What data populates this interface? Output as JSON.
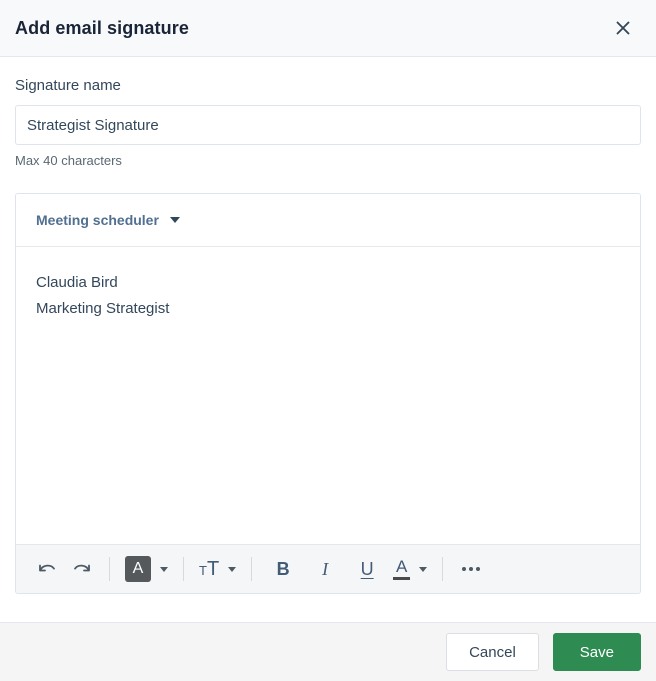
{
  "header": {
    "title": "Add email signature",
    "close_icon": "close-icon"
  },
  "form": {
    "name_label": "Signature name",
    "name_value": "Strategist Signature",
    "name_placeholder": "Signature name",
    "helper_text": "Max 40 characters"
  },
  "editor": {
    "dropdown_label": "Meeting scheduler",
    "dropdown_caret_icon": "chevron-down-icon",
    "signature_lines": [
      "Claudia Bird",
      "Marketing Strategist"
    ],
    "toolbar": {
      "undo_icon": "undo-icon",
      "redo_icon": "redo-icon",
      "font_family_label": "A",
      "font_family_caret_icon": "chevron-down-icon",
      "font_size_small_label": "T",
      "font_size_large_label": "T",
      "font_size_caret_icon": "chevron-down-icon",
      "bold_label": "B",
      "italic_label": "I",
      "underline_label": "U",
      "text_color_label": "A",
      "text_color_caret_icon": "chevron-down-icon",
      "more_icon": "ellipsis-icon"
    }
  },
  "footer": {
    "cancel_label": "Cancel",
    "save_label": "Save"
  },
  "colors": {
    "primary": "#2e8b52",
    "header_bg": "#f8f9fa",
    "toolbar_bg": "#f5f6f7",
    "footer_bg": "#f5f5f5",
    "border": "#dfe3eb",
    "text": "#33475b",
    "muted_text": "#5a6872",
    "dropdown_text": "#516f90",
    "active_chip_bg": "#56595c"
  }
}
